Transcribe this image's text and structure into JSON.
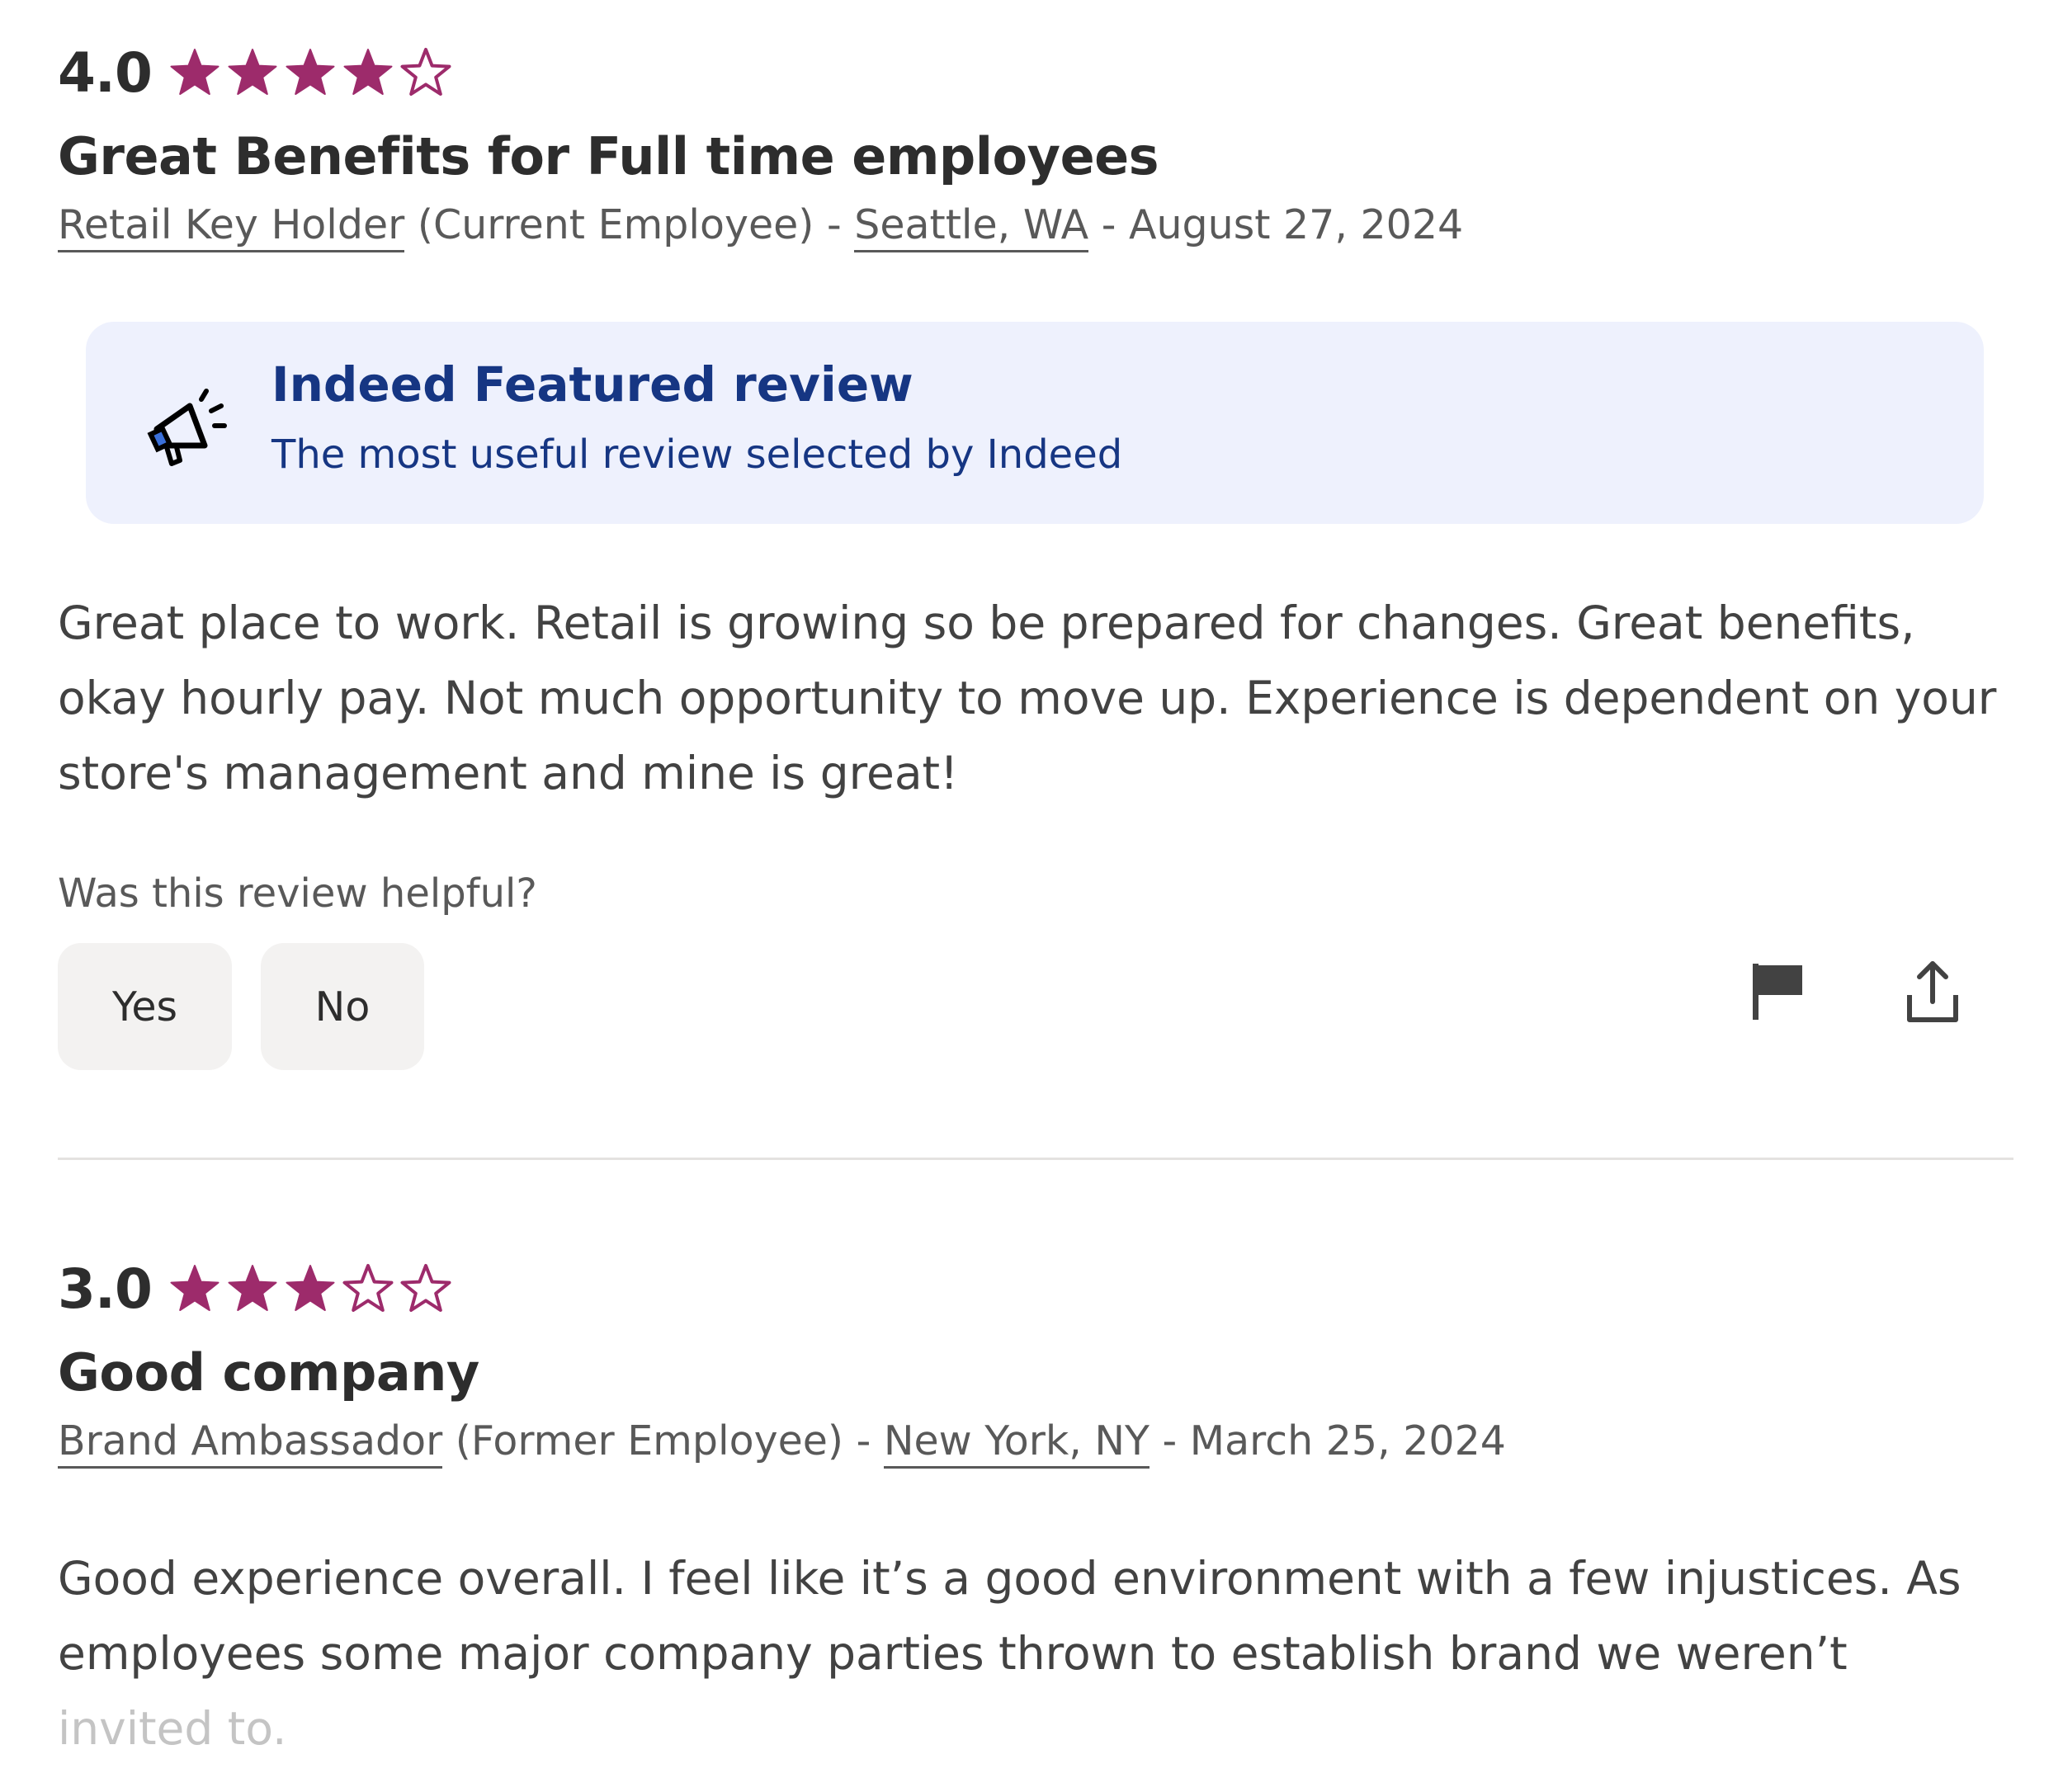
{
  "colors": {
    "star": "#9d2b6b",
    "featured_bg": "#eef1fd",
    "featured_text": "#163683",
    "button_bg": "#f3f2f1",
    "divider": "#e4e2e0"
  },
  "reviews": [
    {
      "rating": "4.0",
      "rating_value": 4,
      "rating_max": 5,
      "title": "Great Benefits for Full time employees",
      "job_title": "Retail Key Holder",
      "status": "(Current Employee) - ",
      "location": "Seattle, WA",
      "date": " - August 27, 2024",
      "featured": {
        "icon": "megaphone-icon",
        "title": "Indeed Featured review",
        "subtitle": "The most useful review selected by Indeed"
      },
      "text": "Great place to work. Retail is growing so be prepared for changes. Great benefits, okay hourly pay. Not much opportunity to move up. Experience is dependent on your store's management and mine is great!",
      "helpful_question": "Was this review helpful?",
      "yes_label": "Yes",
      "no_label": "No",
      "report_icon": "flag-icon",
      "share_icon": "share-icon"
    },
    {
      "rating": "3.0",
      "rating_value": 3,
      "rating_max": 5,
      "title": "Good company",
      "job_title": "Brand Ambassador",
      "status": "(Former Employee) - ",
      "location": "New York, NY",
      "date": " - March 25, 2024",
      "text_main": "Good experience overall. I feel like it’s a good environment with a few injustices. As employees some major company parties thrown to establish brand we weren’t",
      "text_faded": "invited to."
    }
  ]
}
